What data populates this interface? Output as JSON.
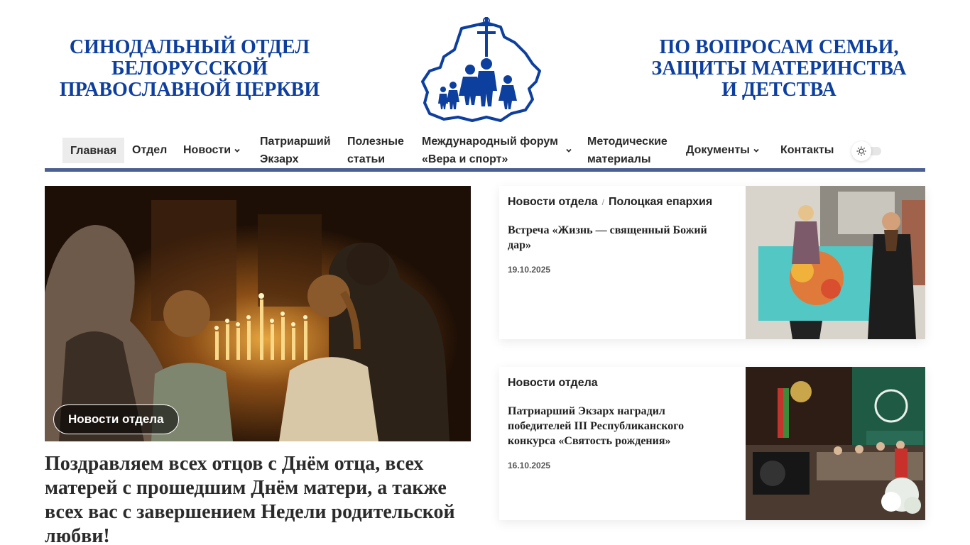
{
  "header": {
    "left_title": [
      "СИНОДАЛЬНЫЙ ОТДЕЛ",
      "БЕЛОРУССКОЙ",
      "ПРАВОСЛАВНОЙ ЦЕРКВИ"
    ],
    "right_title": [
      "ПО ВОПРОСАМ СЕМЬИ,",
      "ЗАЩИТЫ МАТЕРИНСТВА",
      "И ДЕТСТВА"
    ]
  },
  "nav": {
    "items": [
      {
        "label": "Главная"
      },
      {
        "label": "Отдел"
      },
      {
        "label": "Новости"
      },
      {
        "label_1": "Патриарший",
        "label_2": "Экзарх"
      },
      {
        "label_1": "Полезные",
        "label_2": "статьи"
      },
      {
        "label_1": "Международный форум",
        "label_2": "«Вера и спорт»"
      },
      {
        "label_1": "Методические",
        "label_2": "материалы"
      },
      {
        "label": "Документы"
      },
      {
        "label": "Контакты"
      }
    ]
  },
  "hero": {
    "category": "Новости отдела",
    "title": "Поздравляем всех отцов с Днём отца, всех матерей с прошедшим Днём матери, а также всех вас с завершением Недели родительской любви!"
  },
  "cards": [
    {
      "categories": [
        "Новости отдела",
        "Полоцкая епархия"
      ],
      "title": "Встреча «Жизнь — священный Божий дар»",
      "date": "19.10.2025"
    },
    {
      "categories": [
        "Новости отдела"
      ],
      "title": "Патриарший Экзарх наградил победителей III Республиканского конкурса «Святость рождения»",
      "date": "16.10.2025"
    }
  ],
  "colors": {
    "brand_blue": "#0d3f9e",
    "nav_bar": "#4b5f93"
  }
}
